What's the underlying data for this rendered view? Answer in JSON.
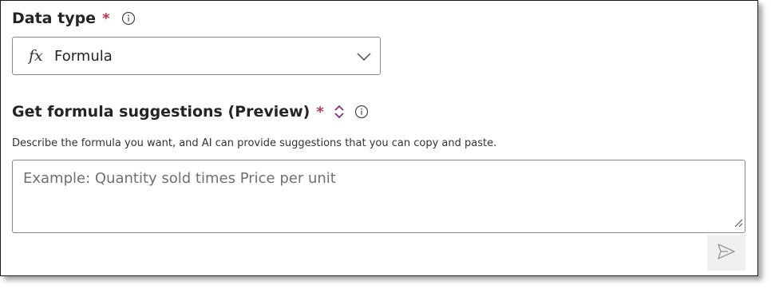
{
  "data_type": {
    "label": "Data type",
    "required_mark": "*",
    "selected_icon": "fx-formula-icon",
    "selected_icon_text": "fx",
    "selected_value": "Formula"
  },
  "formula_suggestions": {
    "label": "Get formula suggestions (Preview)",
    "required_mark": "*",
    "description": "Describe the formula you want, and AI can provide suggestions that you can copy and paste.",
    "input_placeholder": "Example: Quantity sold times Price per unit",
    "input_value": ""
  },
  "colors": {
    "required": "#c4314b",
    "copilot_icon": "#8a2c7a",
    "border": "#8a8a8a",
    "send_bg": "#f0f0f0"
  }
}
